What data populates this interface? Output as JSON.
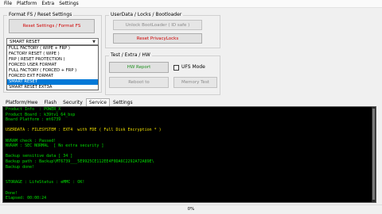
{
  "menu": [
    "File",
    "Platform",
    "Extra",
    "Settings"
  ],
  "format_group": {
    "title": "Format FS / Reset Settings",
    "reset_button": "Reset Settings / Format FS",
    "combo_value": "SMART RESET",
    "options": [
      "FULL FACTORY ( WIPE + FRP )",
      "FACTORY RESET ( WIPE )",
      "FRP ( RESET PROTECTION )",
      "FORCED USER FORMAT",
      "FULL FACTORY ( FORCED + FRP )",
      "FORCED EXT FORMAT",
      "SMART RESET",
      "SMART RESET EXT3A"
    ],
    "selected_option": "SMART RESET"
  },
  "userdata_group": {
    "title": "UserData / Locks / Bootloader",
    "unlock_button": "Unlock BootLoader ( ID safe )",
    "reset_privacy_button": "Reset PrivacyLocks"
  },
  "test_group": {
    "title": "Test / Extra / HW",
    "hw_report_button": "HW Report",
    "ufs_mode_label": "UFS Mode",
    "reboot_button": "Reboot to",
    "memory_test_button": "Memory Test"
  },
  "tabs": [
    "Platform/Hwe",
    "Flash",
    "Security",
    "Service",
    "Settings"
  ],
  "active_tab": "Service",
  "log_lines": [
    {
      "text": "Product Info  : POWER_X",
      "color": "green"
    },
    {
      "text": "Product Board : k39tv1_64_bsp",
      "color": "green"
    },
    {
      "text": "Board Platform : mt6739",
      "color": "green"
    },
    {
      "text": "",
      "color": "green"
    },
    {
      "text": "USERDATA : FILESYSTEM : EXT4  with FDE ( Full Disk Encryption * )",
      "color": "yellow"
    },
    {
      "text": "",
      "color": "green"
    },
    {
      "text": "NVRAM check : Passed!",
      "color": "green"
    },
    {
      "text": "NVRAM : SEC NORMAL  [ No extra security ]",
      "color": "green"
    },
    {
      "text": "",
      "color": "green"
    },
    {
      "text": "Backup sensitive data [ 34 ]",
      "color": "green"
    },
    {
      "text": "Backup path : Backup\\MT6739___5E9925CE112EE4F0DA6C2292A72A89E\\",
      "color": "green"
    },
    {
      "text": "Backup done!",
      "color": "green"
    },
    {
      "text": "",
      "color": "green"
    },
    {
      "text": "",
      "color": "green"
    },
    {
      "text": "STORAGE : LifeStatus : eMMC : OK!",
      "color": "green"
    },
    {
      "text": "",
      "color": "green"
    },
    {
      "text": "Done!",
      "color": "green"
    },
    {
      "text": "Elapsed: 00:00:24",
      "color": "green"
    }
  ],
  "status": {
    "progress_text": "0%"
  }
}
